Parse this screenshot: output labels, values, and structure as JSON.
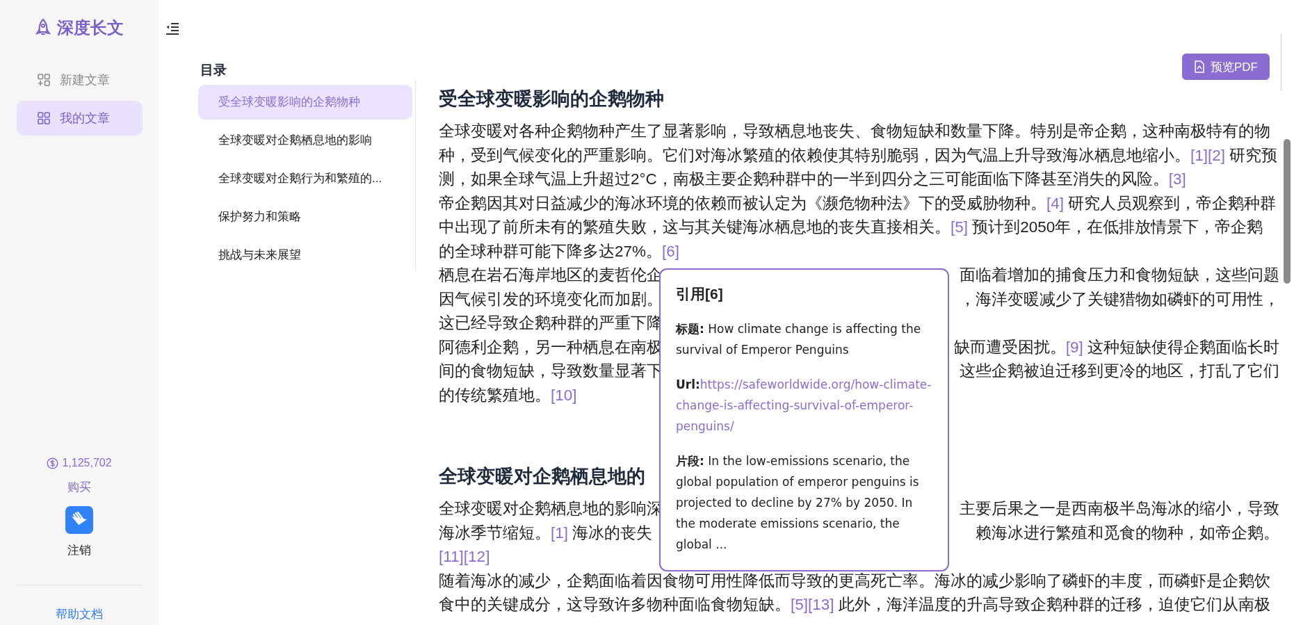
{
  "sidebar": {
    "logo": "深度长文",
    "nav": [
      {
        "label": "新建文章",
        "kind": "new",
        "selected": false
      },
      {
        "label": "我的文章",
        "kind": "list",
        "selected": true
      }
    ],
    "balance": "1,125,702",
    "buy": "购买",
    "logout": "注销",
    "help": "帮助文档"
  },
  "toc": {
    "title": "目录",
    "items": [
      {
        "label": "受全球变暖影响的企鹅物种",
        "selected": true
      },
      {
        "label": "全球变暖对企鹅栖息地的影响",
        "selected": false
      },
      {
        "label": "全球变暖对企鹅行为和繁殖的...",
        "selected": false
      },
      {
        "label": "保护努力和策略",
        "selected": false
      },
      {
        "label": "挑战与未来展望",
        "selected": false
      }
    ]
  },
  "toolbar": {
    "preview_button": "预览PDF"
  },
  "article": {
    "sections": [
      {
        "heading": "受全球变暖影响的企鹅物种",
        "lines": [
          [
            {
              "kind": "text",
              "text": "全球变暖对各种企鹅物种产生了显著影响，导致栖息地丧失、食物短缺和数量下降。特别是帝企鹅，这种南极特有的物"
            }
          ],
          [
            {
              "kind": "text",
              "text": "种，受到气候变化的严重影响。它们对海冰繁殖的依赖使其特别脆弱，因为气温上升导致海冰栖息地缩小。"
            },
            {
              "kind": "cite",
              "text": "[1][2]"
            },
            {
              "kind": "text",
              "text": " 研究预"
            }
          ],
          [
            {
              "kind": "text",
              "text": "测，如果全球气温上升超过2°C，南极主要企鹅种群中的一半到四分之三可能面临下降甚至消失的风险。"
            },
            {
              "kind": "cite",
              "text": "[3]"
            }
          ],
          [
            {
              "kind": "text",
              "text": "帝企鹅因其对日益减少的海冰环境的依赖而被认定为《濒危物种法》下的受威胁物种。"
            },
            {
              "kind": "cite",
              "text": "[4]"
            },
            {
              "kind": "text",
              "text": " 研究人员观察到，帝企鹅种群"
            }
          ],
          [
            {
              "kind": "text",
              "text": "中出现了前所未有的繁殖失败，这与其关键海冰栖息地的丧失直接相关。"
            },
            {
              "kind": "cite",
              "text": "[5]"
            },
            {
              "kind": "text",
              "text": " 预计到2050年，在低排放情景下，帝企鹅"
            }
          ],
          [
            {
              "kind": "text",
              "text": "的全球种群可能下降多达27%。"
            },
            {
              "kind": "cite",
              "text": "[6]"
            }
          ],
          [
            {
              "kind": "text",
              "text": "栖息在岩石海岸地区的麦哲伦企"
            },
            {
              "kind": "gap"
            },
            {
              "kind": "text",
              "text": "面临着增加的捕食压力和食物短缺，这些问题"
            }
          ],
          [
            {
              "kind": "text",
              "text": "因气候引发的环境变化而加剧。"
            },
            {
              "kind": "gap"
            },
            {
              "kind": "text",
              "text": "，海洋变暖减少了关键猎物如磷虾的可用性，"
            }
          ],
          [
            {
              "kind": "text",
              "text": "这已经导致企鹅种群的严重下降"
            },
            {
              "kind": "gap"
            }
          ],
          [
            {
              "kind": "text",
              "text": "阿德利企鹅，另一种栖息在南极"
            },
            {
              "kind": "gap"
            },
            {
              "kind": "text",
              "text": "缺而遭受困扰。"
            },
            {
              "kind": "cite",
              "text": "[9]"
            },
            {
              "kind": "text",
              "text": " 这种短缺使得企鹅面临长时"
            }
          ],
          [
            {
              "kind": "text",
              "text": "间的食物短缺，导致数量显著下"
            },
            {
              "kind": "gap"
            },
            {
              "kind": "text",
              "text": "这些企鹅被迫迁移到更冷的地区，打乱了它们"
            }
          ],
          [
            {
              "kind": "text",
              "text": "的传统繁殖地。"
            },
            {
              "kind": "cite",
              "text": "[10]"
            }
          ]
        ]
      },
      {
        "heading": "全球变暖对企鹅栖息地的",
        "lines": [
          [
            {
              "kind": "text",
              "text": "全球变暖对企鹅栖息地的影响深"
            },
            {
              "kind": "gap"
            },
            {
              "kind": "text",
              "text": "主要后果之一是西南极半岛海冰的缩小，导致"
            }
          ],
          [
            {
              "kind": "text",
              "text": "海冰季节缩短。"
            },
            {
              "kind": "cite",
              "text": "[1]"
            },
            {
              "kind": "text",
              "text": " 海冰的丧失"
            },
            {
              "kind": "gap"
            },
            {
              "kind": "text",
              "text": "赖海冰进行繁殖和觅食的物种，如帝企鹅。"
            }
          ],
          [
            {
              "kind": "cite",
              "text": "[11][12]"
            }
          ],
          [
            {
              "kind": "text",
              "text": "随着海冰的减少，企鹅面临着因食物可用性降低而导致的更高死亡率。海冰的减少影响了磷虾的丰度，而磷虾是企鹅饮"
            }
          ],
          [
            {
              "kind": "text",
              "text": "食中的关键成分，这导致许多物种面临食物短缺。"
            },
            {
              "kind": "cite",
              "text": "[5][13]"
            },
            {
              "kind": "text",
              "text": " 此外，海洋温度的升高导致企鹅种群的迁移，迫使它们从南极"
            }
          ]
        ]
      }
    ]
  },
  "citation_popup": {
    "title": "引用[6]",
    "fields": [
      {
        "kind": "text",
        "text": "**标题:** How climate change is affecting the survival of Emperor Penguins"
      },
      {
        "kind": "link",
        "label": "Url:",
        "url": "https://safeworldwide.org/how-climate-change-is-affecting-survival-of-emperor-penguins/"
      },
      {
        "kind": "text",
        "text": "**片段:** In the low-emissions scenario, the global population of emperor penguins is projected to decline by 27% by 2050. In the moderate emissions scenario, the global ..."
      }
    ]
  }
}
